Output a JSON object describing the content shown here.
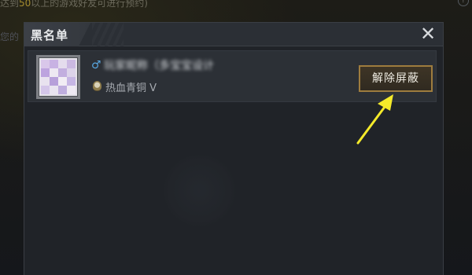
{
  "background": {
    "hint_prefix": "达到",
    "hint_number": "50",
    "hint_suffix": "以上的游戏好友可进行预约)",
    "side_text": "您的"
  },
  "modal": {
    "title": "黑名单",
    "close_label": "✕"
  },
  "blacklist": [
    {
      "gender_symbol": "♂",
      "name": "玩家昵称（多宝宝设计",
      "rank": "热血青铜 V",
      "action_label": "解除屏蔽"
    }
  ],
  "colors": {
    "accent_gold": "#9e7c3e",
    "arrow_yellow": "#f4ea2a",
    "gender_blue": "#58a6e0"
  },
  "avatar_mosaic": [
    "#d9c7ea",
    "#c8b2e3",
    "#e4dced",
    "#cbb9e2",
    "#bda4df",
    "#ede8f2",
    "#c2aedf",
    "#dcd3ea",
    "#e8e2ef",
    "#b7a0da",
    "#f1edf4",
    "#c6b6e4",
    "#d4c6e9",
    "#e9e4f0",
    "#bfaede",
    "#efeaf3"
  ]
}
